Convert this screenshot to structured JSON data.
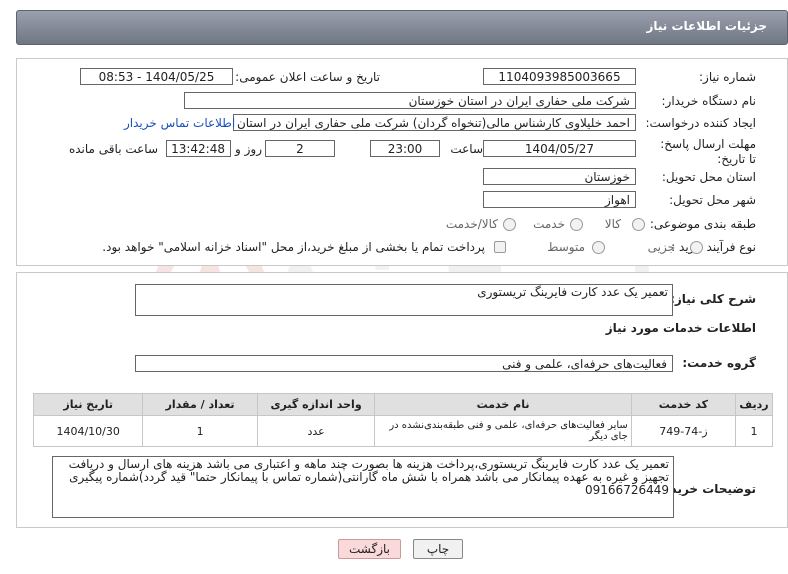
{
  "header": {
    "title": "جزئیات اطلاعات نیاز"
  },
  "form": {
    "need_number": {
      "label": "شماره نیاز:",
      "value": "1104093985003665"
    },
    "announce_datetime": {
      "label": "تاریخ و ساعت اعلان عمومی:",
      "value": "1404/05/25 - 08:53"
    },
    "buyer_org": {
      "label": "نام دستگاه خریدار:",
      "value": "شرکت ملی حفاری ایران در استان خوزستان"
    },
    "requester": {
      "label": "ایجاد کننده درخواست:",
      "value": "احمد خلیلاوی کارشناس مالی(تنخواه گردان) شرکت ملی حفاری ایران در استان",
      "contact_link": "اطلاعات تماس خریدار"
    },
    "deadline": {
      "label": "مهلت ارسال پاسخ: تا تاریخ:",
      "date": "1404/05/27",
      "time_label": "ساعت",
      "time": "23:00",
      "days": "2",
      "days_label": "روز و",
      "remaining": "13:42:48",
      "remaining_label": "ساعت باقی مانده"
    },
    "province": {
      "label": "استان محل تحویل:",
      "value": "خوزستان"
    },
    "city": {
      "label": "شهر محل تحویل:",
      "value": "اهواز"
    },
    "category": {
      "label": "طبقه بندی موضوعی:",
      "options": [
        "کالا",
        "خدمت",
        "کالا/خدمت"
      ]
    },
    "purchase_type": {
      "label": "نوع فرآیند خرید :",
      "options": [
        "جزیی",
        "متوسط"
      ],
      "payment_note": "پرداخت تمام یا بخشی از مبلغ خرید،از محل \"اسناد خزانه اسلامی\" خواهد بود."
    }
  },
  "summary": {
    "label": "شرح کلی نیاز:",
    "value": "تعمیر یک عدد کارت فایرینگ تریستوری"
  },
  "services": {
    "section_title": "اطلاعات خدمات مورد نیاز",
    "group_label": "گروه خدمت:",
    "group_value": "فعالیت‌های حرفه‌ای، علمی و فنی",
    "columns": [
      "ردیف",
      "کد خدمت",
      "نام خدمت",
      "واحد اندازه گیری",
      "تعداد / مقدار",
      "تاریخ نیاز"
    ],
    "rows": [
      {
        "row": "1",
        "code": "ز-74-749",
        "name": "سایر فعالیت‌های حرفه‌ای، علمی و فنی طبقه‌بندی‌نشده در جای دیگر",
        "unit": "عدد",
        "qty": "1",
        "date": "1404/10/30"
      }
    ]
  },
  "buyer_notes": {
    "label": "توضیحات خریدار:",
    "value": "تعمیر یک عدد کارت فایرینگ تریستوری،پرداخت هزینه ها بصورت چند ماهه و اعتباری می باشد هزینه های ارسال و دریافت تجهیز و غیره به عهده پیمانکار می باشد همراه با شش ماه گارانتی(شماره تماس با پیمانکار حتما\" قید گردد)شماره پیگیری 09166726449"
  },
  "buttons": {
    "print": "چاپ",
    "back": "بازگشت"
  },
  "watermark_text": "AriaTender.neT"
}
